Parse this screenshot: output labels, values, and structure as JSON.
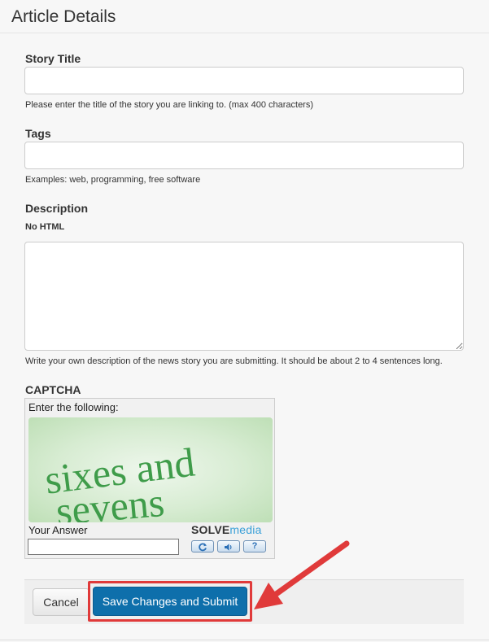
{
  "page": {
    "title": "Article Details"
  },
  "fields": {
    "story_title": {
      "label": "Story Title",
      "value": "",
      "help": "Please enter the title of the story you are linking to. (max 400 characters)"
    },
    "tags": {
      "label": "Tags",
      "value": "",
      "help": "Examples: web, programming, free software"
    },
    "description": {
      "label": "Description",
      "sublabel": "No HTML",
      "value": "",
      "help": "Write your own description of the news story you are submitting. It should be about 2 to 4 sentences long."
    }
  },
  "captcha": {
    "label": "CAPTCHA",
    "instruction": "Enter the following:",
    "challenge_line1": "sixes and",
    "challenge_line2": "sevens",
    "answer_label": "Your Answer",
    "answer_value": "",
    "brand_bold": "SOLVE",
    "brand_light": "media",
    "help_button": "?",
    "refresh_icon": "refresh-icon",
    "audio_icon": "speaker-icon"
  },
  "actions": {
    "cancel_label": "Cancel",
    "submit_label": "Save Changes and Submit"
  },
  "colors": {
    "primary": "#0e6fab",
    "annotation": "#e03a3a",
    "captcha_text": "#3f9c4a",
    "brand_accent": "#3aa0d8"
  }
}
